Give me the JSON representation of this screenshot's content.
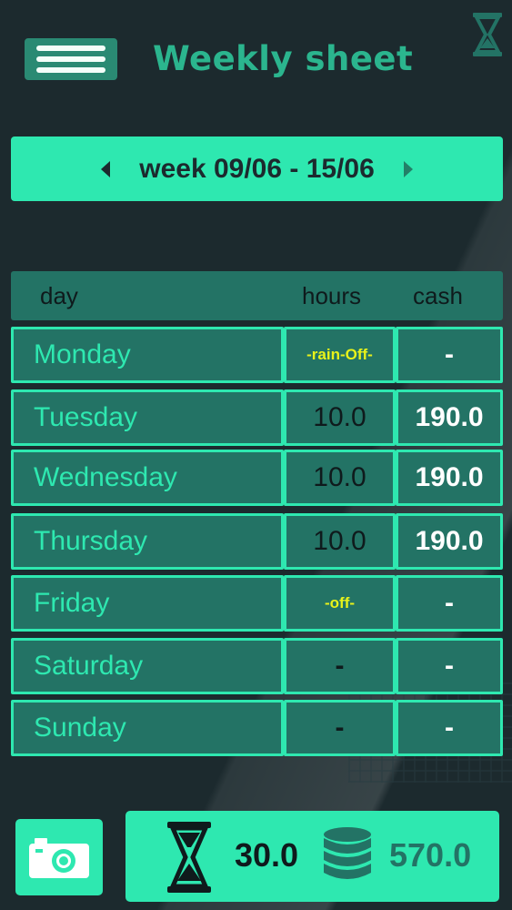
{
  "header": {
    "title": "Weekly sheet",
    "menu_icon": "hamburger-menu-icon",
    "right_icon": "hourglass-icon"
  },
  "week_selector": {
    "label": "week 09/06 - 15/06",
    "prev_icon": "triangle-left-icon",
    "next_icon": "triangle-right-icon"
  },
  "table": {
    "headers": {
      "day": "day",
      "hours": "hours",
      "cash": "cash"
    },
    "rows": [
      {
        "day": "Monday",
        "hours": "-rain-Off-",
        "cash": "-"
      },
      {
        "day": "Tuesday",
        "hours": "10.0",
        "cash": "190.0"
      },
      {
        "day": "Wednesday",
        "hours": "10.0",
        "cash": "190.0"
      },
      {
        "day": "Thursday",
        "hours": "10.0",
        "cash": "190.0"
      },
      {
        "day": "Friday",
        "hours": "-off-",
        "cash": "-"
      },
      {
        "day": "Saturday",
        "hours": "-",
        "cash": "-"
      },
      {
        "day": "Sunday",
        "hours": "-",
        "cash": "-"
      }
    ]
  },
  "totals": {
    "hours": "30.0",
    "cash": "570.0",
    "hours_icon": "hourglass-icon",
    "cash_icon": "coin-stack-icon"
  },
  "camera_icon": "camera-icon",
  "colors": {
    "background": "#1c2a2e",
    "accent": "#2ee8b0",
    "cell": "#237365",
    "note": "#e8f21a"
  }
}
